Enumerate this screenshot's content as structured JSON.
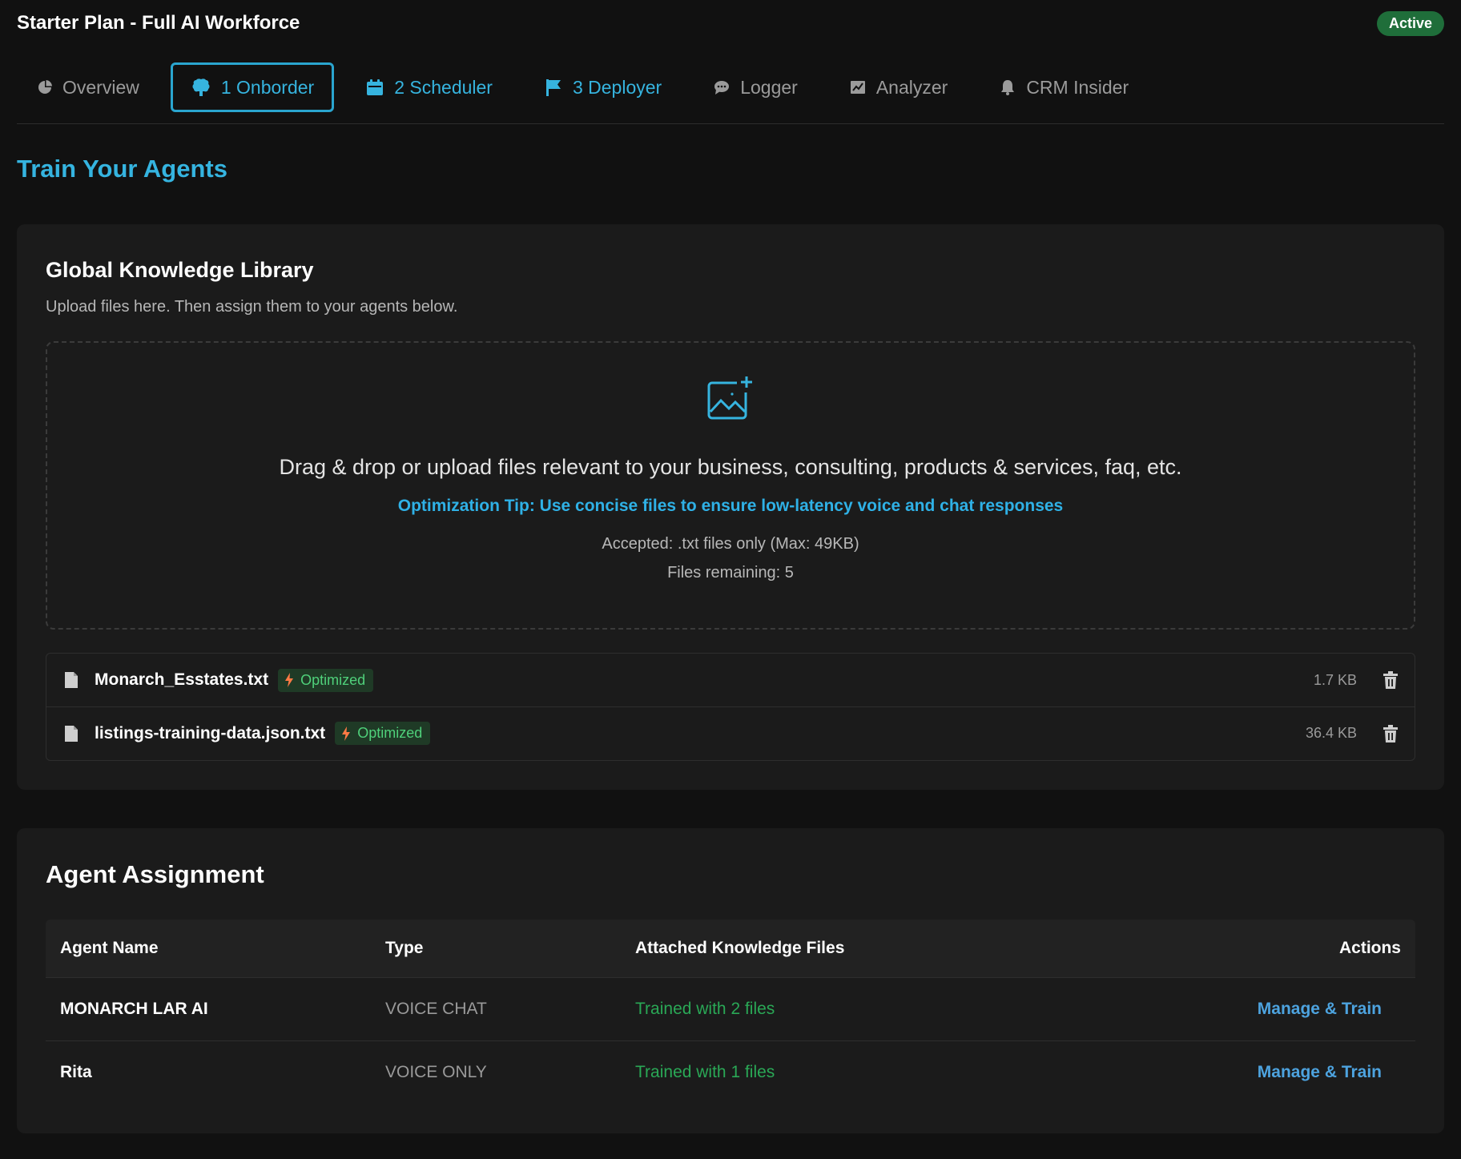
{
  "header": {
    "plan_title": "Starter Plan - Full AI Workforce",
    "status": "Active"
  },
  "tabs": [
    {
      "label": "Overview",
      "icon": "pie-chart-icon",
      "active": false
    },
    {
      "label": "1 Onborder",
      "icon": "brain-icon",
      "active": true
    },
    {
      "label": "2 Scheduler",
      "icon": "calendar-icon",
      "active": false
    },
    {
      "label": "3 Deployer",
      "icon": "flag-icon",
      "active": false
    },
    {
      "label": "Logger",
      "icon": "chat-bubble-icon",
      "active": false
    },
    {
      "label": "Analyzer",
      "icon": "chart-icon",
      "active": false
    },
    {
      "label": "CRM Insider",
      "icon": "bell-icon",
      "active": false
    }
  ],
  "page": {
    "title": "Train Your Agents"
  },
  "library": {
    "title": "Global Knowledge Library",
    "subtitle": "Upload files here. Then assign them to your agents below.",
    "dropzone": {
      "icon": "image-plus-icon",
      "main_text": "Drag & drop or upload files relevant to your business, consulting, products & services, faq, etc.",
      "tip": "Optimization Tip: Use concise files to ensure low-latency voice and chat responses",
      "accepted": "Accepted: .txt files only (Max: 49KB)",
      "remaining": "Files remaining: 5"
    },
    "files": [
      {
        "name": "Monarch_Esstates.txt",
        "badge": "Optimized",
        "size": "1.7 KB"
      },
      {
        "name": "listings-training-data.json.txt",
        "badge": "Optimized",
        "size": "36.4 KB"
      }
    ]
  },
  "assignment": {
    "title": "Agent Assignment",
    "columns": {
      "name": "Agent Name",
      "type": "Type",
      "files": "Attached Knowledge Files",
      "actions": "Actions"
    },
    "rows": [
      {
        "name": "MONARCH LAR AI",
        "type": "VOICE CHAT",
        "files": "Trained with 2 files",
        "action": "Manage & Train"
      },
      {
        "name": "Rita",
        "type": "VOICE ONLY",
        "files": "Trained with 1 files",
        "action": "Manage & Train"
      }
    ]
  },
  "colors": {
    "accent": "#36b4df",
    "success": "#2aa856",
    "badge_bg": "#1f6e3a",
    "background": "#111111",
    "card": "#1b1b1b"
  }
}
